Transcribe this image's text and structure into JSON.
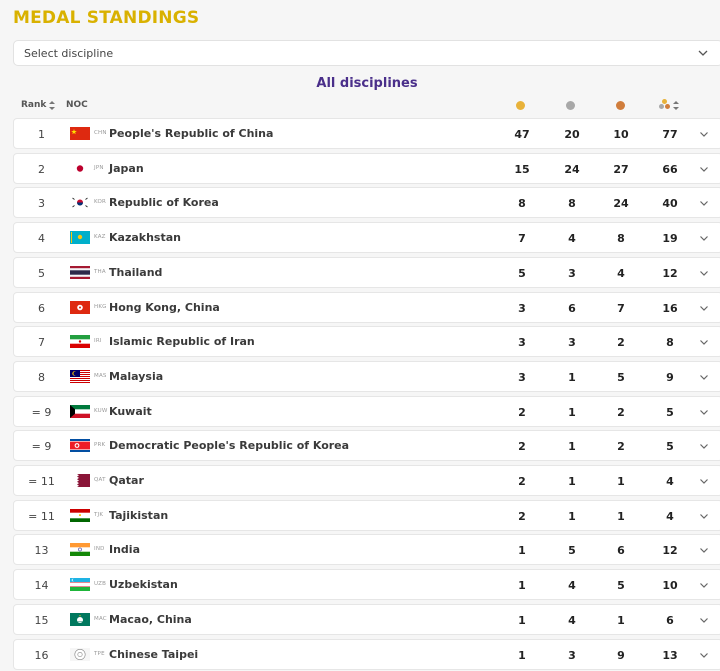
{
  "header": {
    "title": "MEDAL STANDINGS",
    "select_placeholder": "Select discipline",
    "subtitle": "All disciplines",
    "col_rank": "Rank",
    "col_noc": "NOC"
  },
  "colors": {
    "title": "#d9b100",
    "subtitle": "#4a2f8a",
    "gold": "#e8b23a",
    "silver": "#a8a8a8",
    "bronze": "#d07d3c"
  },
  "rows": [
    {
      "rank": "1",
      "code": "CHN",
      "name": "People's Republic of China",
      "gold": "47",
      "silver": "20",
      "bronze": "10",
      "total": "77",
      "flag": "chn"
    },
    {
      "rank": "2",
      "code": "JPN",
      "name": "Japan",
      "gold": "15",
      "silver": "24",
      "bronze": "27",
      "total": "66",
      "flag": "jpn"
    },
    {
      "rank": "3",
      "code": "KOR",
      "name": "Republic of Korea",
      "gold": "8",
      "silver": "8",
      "bronze": "24",
      "total": "40",
      "flag": "kor"
    },
    {
      "rank": "4",
      "code": "KAZ",
      "name": "Kazakhstan",
      "gold": "7",
      "silver": "4",
      "bronze": "8",
      "total": "19",
      "flag": "kaz"
    },
    {
      "rank": "5",
      "code": "THA",
      "name": "Thailand",
      "gold": "5",
      "silver": "3",
      "bronze": "4",
      "total": "12",
      "flag": "tha"
    },
    {
      "rank": "6",
      "code": "HKG",
      "name": "Hong Kong, China",
      "gold": "3",
      "silver": "6",
      "bronze": "7",
      "total": "16",
      "flag": "hkg"
    },
    {
      "rank": "7",
      "code": "IRI",
      "name": "Islamic Republic of Iran",
      "gold": "3",
      "silver": "3",
      "bronze": "2",
      "total": "8",
      "flag": "iri"
    },
    {
      "rank": "8",
      "code": "MAS",
      "name": "Malaysia",
      "gold": "3",
      "silver": "1",
      "bronze": "5",
      "total": "9",
      "flag": "mas"
    },
    {
      "rank": "= 9",
      "code": "KUW",
      "name": "Kuwait",
      "gold": "2",
      "silver": "1",
      "bronze": "2",
      "total": "5",
      "flag": "kuw"
    },
    {
      "rank": "= 9",
      "code": "PRK",
      "name": "Democratic People's Republic of Korea",
      "gold": "2",
      "silver": "1",
      "bronze": "2",
      "total": "5",
      "flag": "prk"
    },
    {
      "rank": "= 11",
      "code": "QAT",
      "name": "Qatar",
      "gold": "2",
      "silver": "1",
      "bronze": "1",
      "total": "4",
      "flag": "qat"
    },
    {
      "rank": "= 11",
      "code": "TJK",
      "name": "Tajikistan",
      "gold": "2",
      "silver": "1",
      "bronze": "1",
      "total": "4",
      "flag": "tjk"
    },
    {
      "rank": "13",
      "code": "IND",
      "name": "India",
      "gold": "1",
      "silver": "5",
      "bronze": "6",
      "total": "12",
      "flag": "ind"
    },
    {
      "rank": "14",
      "code": "UZB",
      "name": "Uzbekistan",
      "gold": "1",
      "silver": "4",
      "bronze": "5",
      "total": "10",
      "flag": "uzb"
    },
    {
      "rank": "15",
      "code": "MAC",
      "name": "Macao, China",
      "gold": "1",
      "silver": "4",
      "bronze": "1",
      "total": "6",
      "flag": "mac"
    },
    {
      "rank": "16",
      "code": "TPE",
      "name": "Chinese Taipei",
      "gold": "1",
      "silver": "3",
      "bronze": "9",
      "total": "13",
      "flag": "tpe"
    }
  ]
}
